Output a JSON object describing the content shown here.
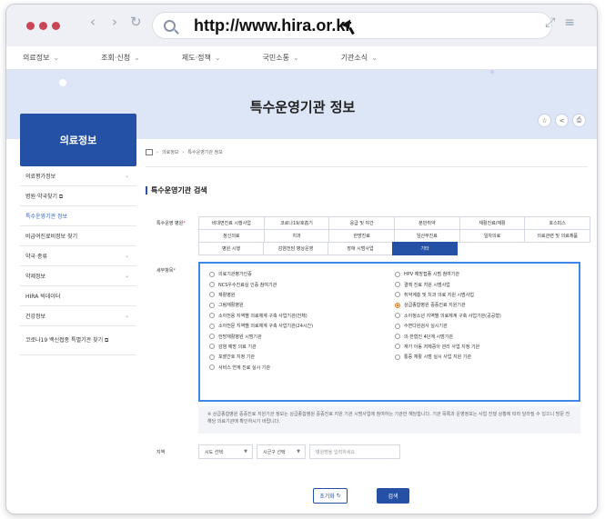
{
  "browser": {
    "url": "http://www.hira.or.kr"
  },
  "top_menu": [
    {
      "label": "의료정보"
    },
    {
      "label": "조회·신청"
    },
    {
      "label": "제도·정책"
    },
    {
      "label": "국민소통"
    },
    {
      "label": "기관소식"
    }
  ],
  "banner": {
    "title": "특수운영기관 정보"
  },
  "sidebar": {
    "title": "의료정보",
    "items": [
      {
        "label": "의료평가정보",
        "chev": "⌄",
        "active": false
      },
      {
        "label": "병원·약국찾기 ⧉",
        "chev": "",
        "active": false
      },
      {
        "label": "특수운영기관 정보",
        "chev": "",
        "active": true
      },
      {
        "label": "비급여진료비정보 찾기",
        "chev": "",
        "active": false
      },
      {
        "label": "약국·종류",
        "chev": "⌄",
        "active": false
      },
      {
        "label": "약제정보",
        "chev": "⌄",
        "active": false
      },
      {
        "label": "HIRA 빅데이터",
        "chev": "",
        "active": false
      },
      {
        "label": "건강정보",
        "chev": "⌄",
        "active": false
      },
      {
        "label": "코로나19 백신접종 특별기관 찾기 ⧉",
        "chev": "",
        "active": false
      }
    ]
  },
  "breadcrumb": {
    "level1": "의료정보",
    "level2": "특수운영기관 정보"
  },
  "section": {
    "title": "특수운영기관 검색"
  },
  "form": {
    "type_label": "특수운영 병원",
    "detail_label": "세부항목",
    "region_label": "지역",
    "type_rows": [
      [
        "비대면진료 시행사업",
        "코로나19/호흡기",
        "응급 및 야간",
        "분만취약",
        "재활진료/재활",
        "호스피스"
      ],
      [
        "정신의료",
        "치과",
        "한방진료",
        "임산부진료",
        "일차의료",
        "의료관련 및 의료제품"
      ],
      [
        "병원 시행",
        "감염전담 병상운영",
        "장애 시범사업",
        "기타"
      ]
    ],
    "selected_type": "기타",
    "detail_left": [
      "의료기관평가인증",
      "NCS우수진료실 인증 참여기관",
      "재활병원",
      "그림재활병원",
      "소아전용 지역별 의료체계 구축 사업기관(전체)",
      "소아전문 지역별 의료체계 구축 사업기관(24시간)",
      "한방재활병원 시범기관",
      "감염 예방 의료 기관",
      "포괄간호 지정 기관",
      "서비스 연계 진료 실시 기관"
    ],
    "detail_right": [
      "HPV 예방접종 시범 참여기관",
      "결핵 진료 지원 시범사업",
      "취약계층 및 치과 의료 지원 시범사업",
      "상급종합병원 중증진료 지원기관",
      "소아청소년 지역별 의료체계 구축 사업기관(공공형)",
      "수면다원검사 실시기관",
      "의·한협진 4단계 시범기관",
      "재가 아동 저체중아 관리 사업 지정 기관",
      "통증 재활 시범 실시 사업 지원 기관"
    ],
    "detail_checked_right_index": 3,
    "note": "※ 상급종합병원 중증진료 지원기관 정보는 상급종합병원 중증진료 지원 기관 시범사업에 참여하는 기관만 해당합니다. 기관 목록과 운영정보는 사업 진행 상황에 따라 달라질 수 있으니 방문 전 해당 의료기관에 확인하시기 바랍니다.",
    "region": {
      "sido": "시도 선택",
      "sigungu": "시군구 선택",
      "placeholder": "병원명을 입력하세요"
    }
  },
  "buttons": {
    "reset": "초기화",
    "search": "검색"
  }
}
